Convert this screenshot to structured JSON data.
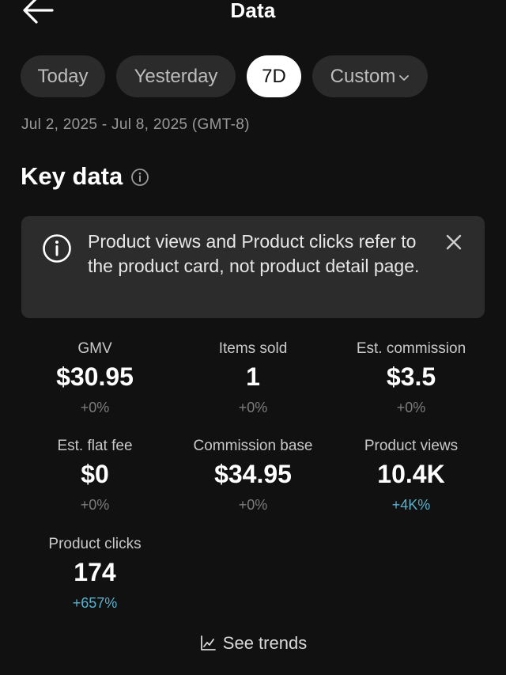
{
  "header": {
    "title": "Data"
  },
  "tabs": [
    {
      "label": "Today",
      "selected": false
    },
    {
      "label": "Yesterday",
      "selected": false
    },
    {
      "label": "7D",
      "selected": true
    },
    {
      "label": "Custom",
      "selected": false
    }
  ],
  "date_range": "Jul 2, 2025 - Jul 8, 2025 (GMT-8)",
  "key_data": {
    "title": "Key data",
    "notice": "Product views and Product clicks refer to the product card, not product detail page."
  },
  "metrics": [
    {
      "label": "GMV",
      "value": "$30.95",
      "change": "+0%"
    },
    {
      "label": "Items sold",
      "value": "1",
      "change": "+0%"
    },
    {
      "label": "Est. commission",
      "value": "$3.5",
      "change": "+0%"
    },
    {
      "label": "Est. flat fee",
      "value": "$0",
      "change": "+0%"
    },
    {
      "label": "Commission base",
      "value": "$34.95",
      "change": "+0%"
    },
    {
      "label": "Product views",
      "value": "10.4K",
      "change": "+4K%"
    },
    {
      "label": "Product clicks",
      "value": "174",
      "change": "+657%"
    }
  ],
  "see_trends": {
    "label": "See trends"
  },
  "colors": {
    "background": "#111111",
    "card": "#2c2c2c",
    "positive_change": "#5ab0cc",
    "neutral_change": "#7c7c7c"
  },
  "icons": {
    "back": "arrow-left-icon",
    "info": "info-circle-icon",
    "close": "close-icon",
    "chevron": "chevron-down-icon",
    "trends": "line-chart-icon"
  }
}
